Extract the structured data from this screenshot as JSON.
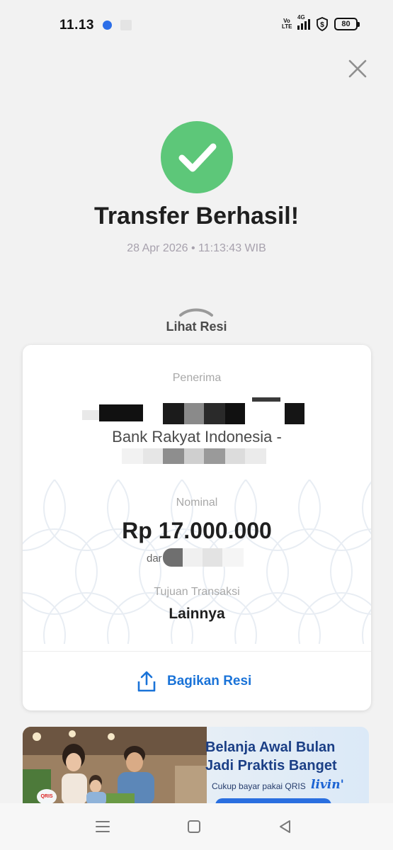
{
  "status_bar": {
    "time": "11.13",
    "network_label": "4G",
    "volte_label": "Vo\nLTE",
    "battery": "80",
    "icons": [
      "app-dot-icon",
      "notification-app-icon",
      "volte-icon",
      "signal-icon",
      "vpn-shield-icon",
      "battery-icon"
    ]
  },
  "colors": {
    "success_green": "#5dc779",
    "accent_blue": "#1a73d8",
    "muted_text": "#a7a1ad",
    "banner_blue": "#1b3f86"
  },
  "header": {
    "close_icon": "close-icon"
  },
  "success": {
    "icon": "check-circle-icon",
    "title": "Transfer Berhasil!",
    "datetime": "28 Apr 2026 • 11:13:43 WIB"
  },
  "receipt_toggle": {
    "icon": "chevron-up-icon",
    "label": "Lihat Resi"
  },
  "receipt": {
    "recipient_label": "Penerima",
    "bank_name": "Bank Rakyat Indonesia -",
    "amount_label": "Nominal",
    "amount": "Rp 17.000.000",
    "from_prefix": "dar",
    "purpose_label": "Tujuan Transaksi",
    "purpose": "Lainnya",
    "share_icon": "share-upload-icon",
    "share_label": "Bagikan Resi"
  },
  "banner": {
    "line1": "Belanja Awal Bulan",
    "line2": "Jadi Praktis Banget",
    "subtitle": "Cukup bayar pakai QRIS",
    "brand": "livin'",
    "qris_badge": "QRIS"
  },
  "nav_bar": {
    "icons": [
      "menu-icon",
      "home-square-icon",
      "back-triangle-icon"
    ]
  }
}
